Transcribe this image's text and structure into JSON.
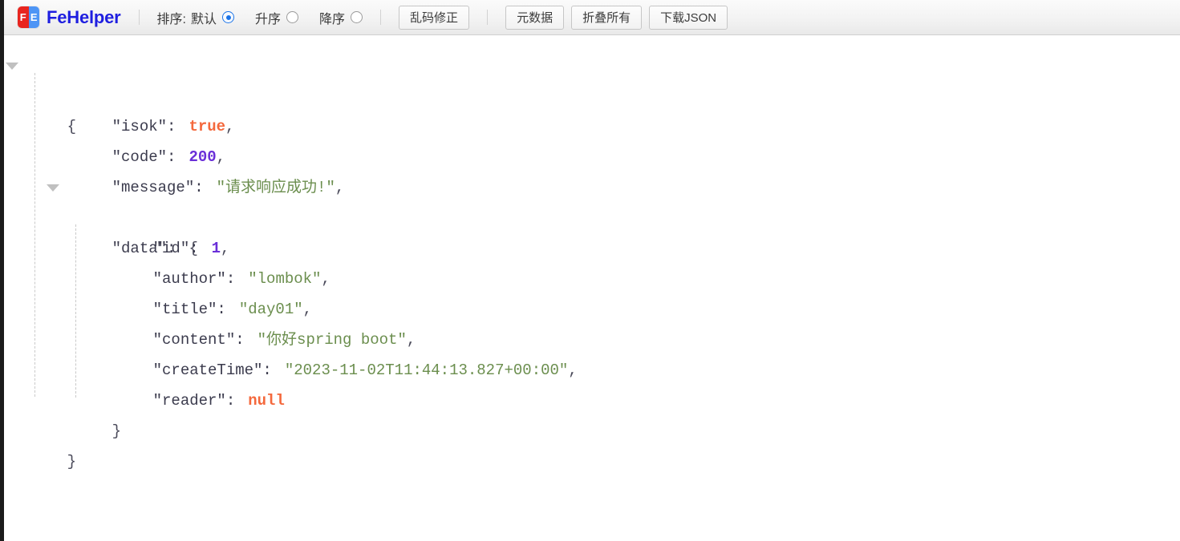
{
  "app": {
    "brand_name": "FeHelper",
    "logo_left_char": "F",
    "logo_right_char": "E"
  },
  "toolbar": {
    "sort_label": "排序:",
    "sort_options": [
      {
        "label": "默认",
        "checked": true
      },
      {
        "label": "升序",
        "checked": false
      },
      {
        "label": "降序",
        "checked": false
      }
    ],
    "fix_encoding_button": "乱码修正",
    "metadata_button": "元数据",
    "collapse_all_button": "折叠所有",
    "download_json_button": "下载JSON"
  },
  "json": {
    "open_brace": "{",
    "close_brace": "}",
    "rows": {
      "isok": {
        "key": "\"isok\":",
        "value": "true",
        "comma": ","
      },
      "code": {
        "key": "\"code\":",
        "value": "200",
        "comma": ","
      },
      "message": {
        "key": "\"message\":",
        "value": "\"请求响应成功!\"",
        "comma": ","
      },
      "data": {
        "key": "\"data\":",
        "open": "{"
      },
      "id": {
        "key": "\"id\":",
        "value": "1",
        "comma": ","
      },
      "author": {
        "key": "\"author\":",
        "value": "\"lombok\"",
        "comma": ","
      },
      "title": {
        "key": "\"title\":",
        "value": "\"day01\"",
        "comma": ","
      },
      "content": {
        "key": "\"content\":",
        "value": "\"你好spring boot\"",
        "comma": ","
      },
      "createTime": {
        "key": "\"createTime\":",
        "value": "\"2023-11-02T11:44:13.827+00:00\"",
        "comma": ","
      },
      "reader": {
        "key": "\"reader\":",
        "value": "null"
      }
    },
    "inner_close_brace": "}",
    "outer_close_brace": "}"
  },
  "colors": {
    "brand": "#1f1fe0",
    "logo_red": "#e8251f",
    "logo_blue": "#4e95f5",
    "radio_accent": "#1a73e8",
    "string_value": "#6b8e4e",
    "number_value": "#6a2fd8",
    "boolean_value": "#f4683c",
    "null_value": "#f4683c"
  }
}
